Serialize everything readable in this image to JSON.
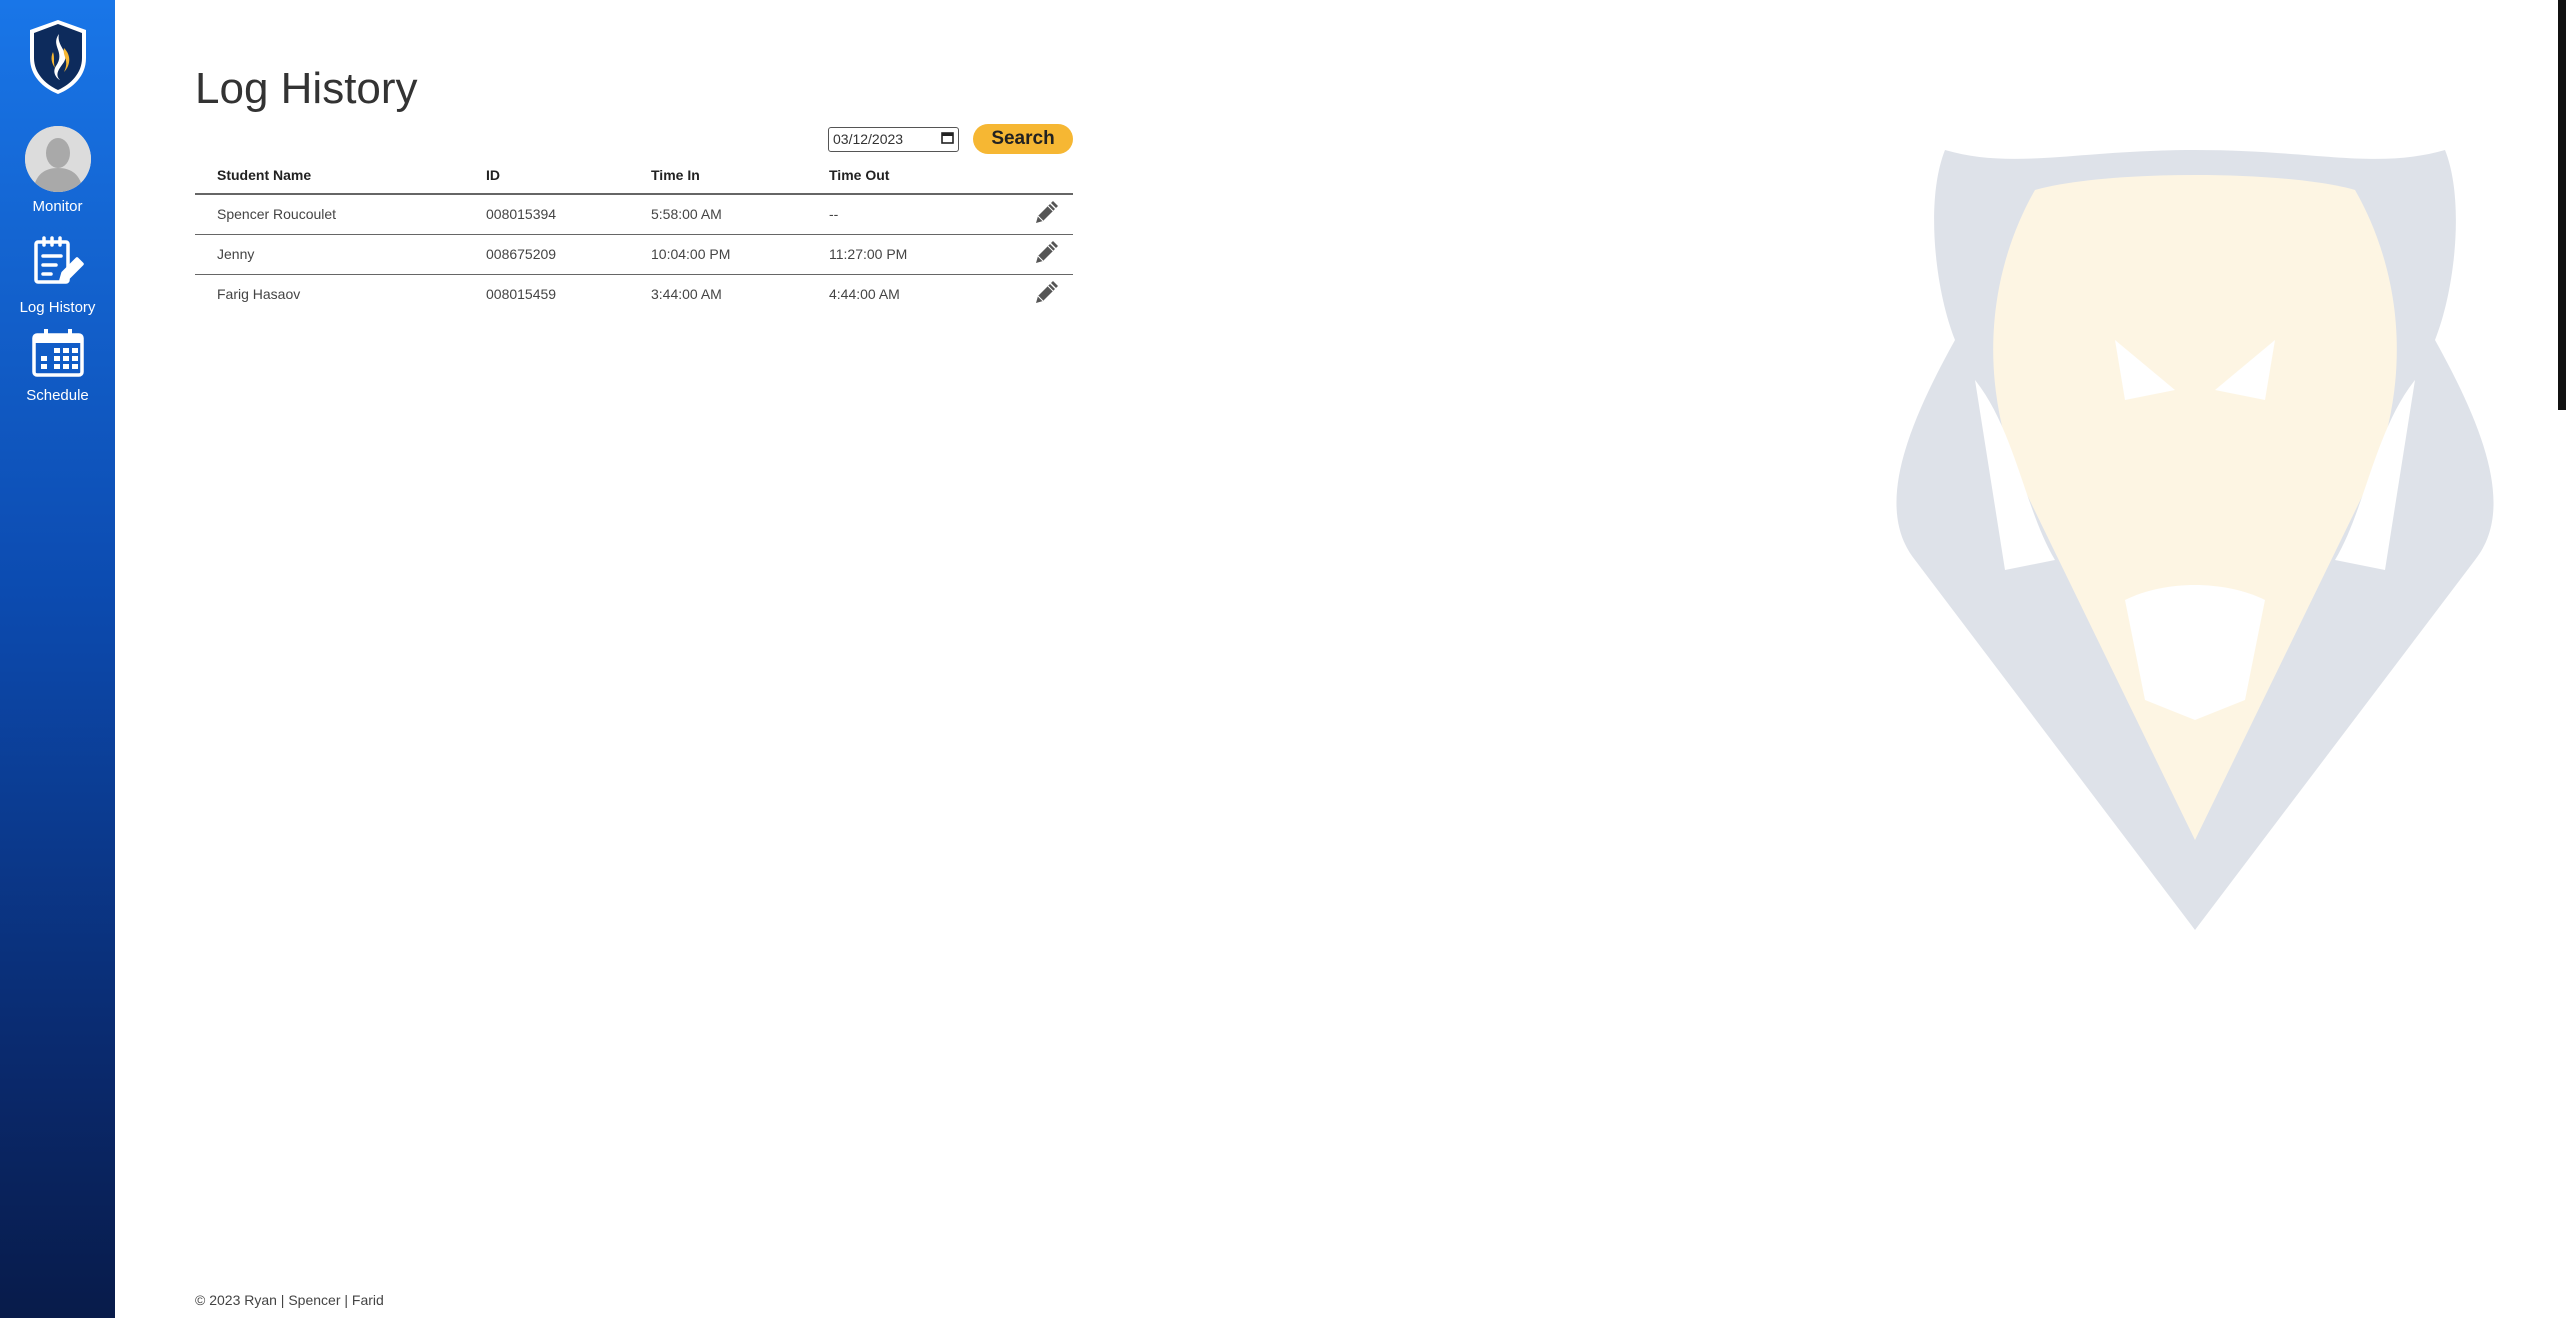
{
  "sidebar": {
    "items": [
      {
        "label": "Monitor",
        "icon": "user-avatar-icon"
      },
      {
        "label": "Log History",
        "icon": "clipboard-edit-icon"
      },
      {
        "label": "Schedule",
        "icon": "calendar-icon"
      }
    ]
  },
  "page": {
    "title": "Log History"
  },
  "search": {
    "date_value": "03/12/2023",
    "button_label": "Search"
  },
  "table": {
    "headers": [
      "Student Name",
      "ID",
      "Time In",
      "Time Out"
    ],
    "rows": [
      {
        "name": "Spencer Roucoulet",
        "id": "008015394",
        "time_in": "5:58:00 AM",
        "time_out": "--"
      },
      {
        "name": "Jenny",
        "id": "008675209",
        "time_in": "10:04:00 PM",
        "time_out": "11:27:00 PM"
      },
      {
        "name": "Farig Hasaov",
        "id": "008015459",
        "time_in": "3:44:00 AM",
        "time_out": "4:44:00 AM"
      }
    ]
  },
  "footer": {
    "text": "© 2023 Ryan | Spencer | Farid"
  },
  "colors": {
    "accent": "#f6b733",
    "sidebar_top": "#1976e8",
    "sidebar_bottom": "#081b4a",
    "shield": "#0d2b5c"
  }
}
